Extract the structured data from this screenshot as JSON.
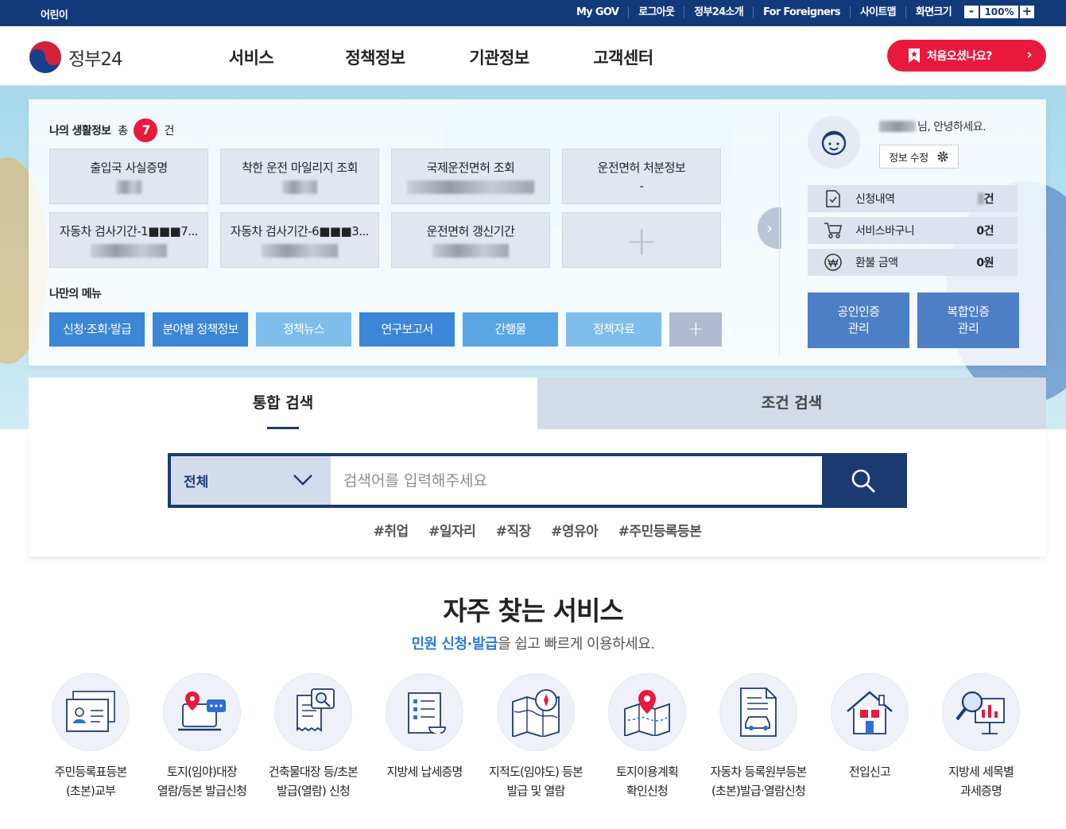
{
  "topbar": {
    "kids": "어린이",
    "links": [
      "My GOV",
      "로그아웃",
      "정부24소개",
      "For Foreigners",
      "사이트맵",
      "화면크기"
    ],
    "zoom_minus": "-",
    "zoom_value": "100%",
    "zoom_plus": "+"
  },
  "header": {
    "logo_text": "정부24",
    "nav": [
      "서비스",
      "정책정보",
      "기관정보",
      "고객센터"
    ],
    "first_visit": "처음오셨나요?"
  },
  "life_info": {
    "title": "나의 생활정보",
    "count_prefix": "총",
    "count": "7",
    "count_unit": "건",
    "cards": [
      {
        "title": "출입국 사실증명",
        "value": ""
      },
      {
        "title": "착한 운전 마일리지 조회",
        "value": ""
      },
      {
        "title": "국제운전면허 조회",
        "value": ""
      },
      {
        "title": "운전면허 처분정보",
        "value": "-"
      },
      {
        "title": "자동차 검사기간-1■■■7...",
        "value": ""
      },
      {
        "title": "자동차 검사기간-6■■■3...",
        "value": ""
      },
      {
        "title": "운전면허 갱신기간",
        "value": ""
      }
    ]
  },
  "my_menu": {
    "title": "나만의 메뉴",
    "items": [
      "신청·조회·발급",
      "분야별 정책정보",
      "정책뉴스",
      "연구보고서",
      "간행물",
      "정책자료"
    ],
    "colors": [
      "#3b86d6",
      "#3b86d6",
      "#7fbdec",
      "#3b86d6",
      "#5aa6e4",
      "#7fbdec"
    ],
    "add": "+"
  },
  "user": {
    "greeting": "님, 안녕하세요.",
    "edit": "정보 수정",
    "stats": [
      {
        "label": "신청내역",
        "value": "건",
        "icon": "document-check-icon"
      },
      {
        "label": "서비스바구니",
        "value": "0건",
        "icon": "cart-icon"
      },
      {
        "label": "환불 금액",
        "value": "0원",
        "icon": "won-icon"
      }
    ],
    "cert_buttons": [
      "공인인증\n관리",
      "복합인증\n관리"
    ]
  },
  "search": {
    "tabs": [
      "통합 검색",
      "조건 검색"
    ],
    "category": "전체",
    "placeholder": "검색어를 입력해주세요",
    "tags": [
      "#취업",
      "#일자리",
      "#직장",
      "#영유아",
      "#주민등록등본"
    ]
  },
  "frequent": {
    "title": "자주 찾는 서비스",
    "subtitle_highlight": "민원 신청·발급",
    "subtitle_rest": "을 쉽고 빠르게 이용하세요.",
    "services": [
      {
        "label": "주민등록표등본\n(초본)교부",
        "icon": "resident-card-icon"
      },
      {
        "label": "토지(임야)대장\n열람/등본 발급신청",
        "icon": "land-register-icon"
      },
      {
        "label": "건축물대장 등/초본\n발급(열람) 신청",
        "icon": "building-register-icon"
      },
      {
        "label": "지방세 납세증명",
        "icon": "tax-scroll-icon"
      },
      {
        "label": "지적도(임야도) 등본\n발급 및 열람",
        "icon": "map-compass-icon"
      },
      {
        "label": "토지이용계획\n확인신청",
        "icon": "map-pin-icon"
      },
      {
        "label": "자동차 등록원부등본\n(초본)발급·열람신청",
        "icon": "car-document-icon"
      },
      {
        "label": "전입신고",
        "icon": "house-icon"
      },
      {
        "label": "지방세 세목별\n과세증명",
        "icon": "chart-magnifier-icon"
      }
    ]
  }
}
